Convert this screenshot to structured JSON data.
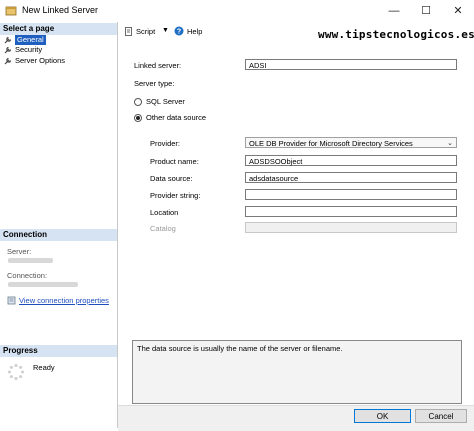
{
  "window": {
    "title": "New Linked Server",
    "minimize_glyph": "—",
    "maximize_glyph": "☐",
    "close_glyph": "✕"
  },
  "watermark": "www.tipstecnologicos.es",
  "left": {
    "select_page_title": "Select a page",
    "pages": [
      {
        "label": "General",
        "icon": "wrench-icon",
        "selected": true
      },
      {
        "label": "Security",
        "icon": "wrench-icon",
        "selected": false
      },
      {
        "label": "Server Options",
        "icon": "wrench-icon",
        "selected": false
      }
    ],
    "connection_title": "Connection",
    "server_label": "Server:",
    "connection_label": "Connection:",
    "view_props_link": "View connection properties",
    "progress_title": "Progress",
    "progress_status": "Ready"
  },
  "toolbar": {
    "script_label": "Script",
    "help_label": "Help"
  },
  "form": {
    "linked_server_label": "Linked server:",
    "linked_server_value": "ADSI",
    "server_type_label": "Server type:",
    "radio_sql": "SQL Server",
    "radio_other": "Other data source",
    "selected_type": "Other data source",
    "provider_label": "Provider:",
    "provider_value": "OLE DB Provider for Microsoft Directory Services",
    "product_name_label": "Product name:",
    "product_name_value": "ADSDSOObject",
    "data_source_label": "Data source:",
    "data_source_value": "adsdatasource",
    "provider_string_label": "Provider string:",
    "provider_string_value": "",
    "location_label": "Location",
    "location_value": "",
    "catalog_label": "Catalog",
    "catalog_value": ""
  },
  "description": "The data source is usually the name of the server or filename.",
  "buttons": {
    "ok": "OK",
    "cancel": "Cancel"
  }
}
